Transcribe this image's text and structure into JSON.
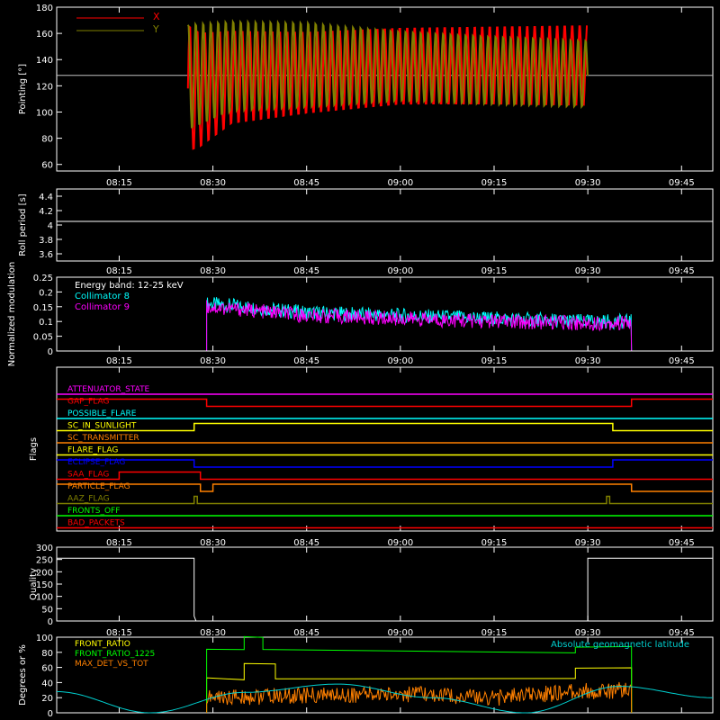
{
  "colors": {
    "background": "#000000",
    "axis": "#ffffff",
    "red": "#ff0000",
    "olive": "#808000",
    "cyan": "#00ffff",
    "magenta": "#ff00ff",
    "white": "#ffffff",
    "yellow": "#ffff00",
    "green": "#00ff00",
    "orange": "#ff8000",
    "blue": "#0000ff",
    "teal": "#00d0d0"
  },
  "time_axis": {
    "tick_labels": [
      "08:15",
      "08:30",
      "08:45",
      "09:00",
      "09:15",
      "09:30",
      "09:45"
    ],
    "start": "08:05",
    "end": "09:50"
  },
  "chart_data": [
    {
      "type": "line",
      "ylabel": "Pointing [°]",
      "ylim": [
        55,
        180
      ],
      "yticks": [
        60,
        80,
        100,
        120,
        140,
        160,
        180
      ],
      "reference_line": 128,
      "data_start": "08:26",
      "data_end": "09:30",
      "series": [
        {
          "name": "X",
          "color": "#ff0000",
          "envelope": [
            {
              "t": "08:26",
              "min": 68,
              "max": 168
            },
            {
              "t": "08:28",
              "min": 72,
              "max": 162
            },
            {
              "t": "08:33",
              "min": 90,
              "max": 163
            },
            {
              "t": "08:45",
              "min": 98,
              "max": 162
            },
            {
              "t": "09:00",
              "min": 105,
              "max": 165
            },
            {
              "t": "09:15",
              "min": 105,
              "max": 166
            },
            {
              "t": "09:30",
              "min": 104,
              "max": 167
            }
          ]
        },
        {
          "name": "Y",
          "color": "#808000",
          "envelope": [
            {
              "t": "08:26",
              "min": 85,
              "max": 168
            },
            {
              "t": "08:33",
              "min": 100,
              "max": 170
            },
            {
              "t": "08:45",
              "min": 103,
              "max": 169
            },
            {
              "t": "09:00",
              "min": 108,
              "max": 162
            },
            {
              "t": "09:15",
              "min": 105,
              "max": 158
            },
            {
              "t": "09:30",
              "min": 103,
              "max": 155
            }
          ]
        }
      ]
    },
    {
      "type": "line",
      "ylabel": "Roll period [s]",
      "ylim": [
        3.5,
        4.5
      ],
      "yticks": [
        3.6,
        3.8,
        4.0,
        4.2,
        4.4
      ],
      "series": [
        {
          "name": "",
          "color": "#ffffff",
          "x": [
            "08:05",
            "09:50"
          ],
          "y": [
            4.05,
            4.05
          ]
        }
      ]
    },
    {
      "type": "line",
      "ylabel": "Normalized modulation",
      "ylim": [
        0,
        0.25
      ],
      "yticks": [
        0.0,
        0.05,
        0.1,
        0.15,
        0.2,
        0.25
      ],
      "annotation": "Energy band: 12-25 keV",
      "data_start": "08:29",
      "data_end": "09:37",
      "series": [
        {
          "name": "Collimator 8",
          "color": "#00ffff",
          "x": [
            "08:29",
            "08:35",
            "08:45",
            "09:00",
            "09:15",
            "09:30",
            "09:37"
          ],
          "y": [
            0.16,
            0.15,
            0.13,
            0.12,
            0.11,
            0.1,
            0.1
          ]
        },
        {
          "name": "Collimator 9",
          "color": "#ff00ff",
          "x": [
            "08:29",
            "08:35",
            "08:45",
            "09:00",
            "09:15",
            "09:30",
            "09:37"
          ],
          "y": [
            0.15,
            0.14,
            0.12,
            0.11,
            0.1,
            0.095,
            0.095
          ]
        }
      ]
    },
    {
      "type": "table",
      "ylabel": "Flags",
      "flags": [
        {
          "name": "ATTENUATOR_STATE",
          "color": "#ff00ff",
          "x": [
            "08:05",
            "09:50"
          ],
          "y": [
            0,
            0
          ]
        },
        {
          "name": "GAP_FLAG",
          "color": "#ff0000",
          "x": [
            "08:05",
            "08:29",
            "08:29",
            "09:37",
            "09:37",
            "09:50"
          ],
          "y": [
            1,
            1,
            0,
            0,
            1,
            1
          ]
        },
        {
          "name": "POSSIBLE_FLARE",
          "color": "#00ffff",
          "x": [
            "08:05",
            "09:50"
          ],
          "y": [
            0,
            0
          ]
        },
        {
          "name": "SC_IN_SUNLIGHT",
          "color": "#ffff00",
          "x": [
            "08:05",
            "08:27",
            "08:27",
            "09:34",
            "09:34",
            "09:50"
          ],
          "y": [
            0,
            0,
            1,
            1,
            0,
            0
          ]
        },
        {
          "name": "SC_TRANSMITTER",
          "color": "#ff8000",
          "x": [
            "08:05",
            "09:50"
          ],
          "y": [
            0,
            0
          ]
        },
        {
          "name": "FLARE_FLAG",
          "color": "#ffff00",
          "x": [
            "08:05",
            "09:50"
          ],
          "y": [
            0,
            0
          ]
        },
        {
          "name": "ECLIPSE_FLAG",
          "color": "#0000ff",
          "x": [
            "08:05",
            "08:27",
            "08:27",
            "09:34",
            "09:34",
            "09:50"
          ],
          "y": [
            1,
            1,
            0,
            0,
            1,
            1
          ]
        },
        {
          "name": "SAA_FLAG",
          "color": "#ff0000",
          "x": [
            "08:05",
            "08:15",
            "08:15",
            "08:28",
            "08:28",
            "09:50"
          ],
          "y": [
            0,
            0,
            1,
            1,
            0,
            0
          ]
        },
        {
          "name": "PARTICLE_FLAG",
          "color": "#ff8000",
          "x": [
            "08:05",
            "08:28",
            "08:28",
            "08:30",
            "08:30",
            "09:37",
            "09:37",
            "09:50"
          ],
          "y": [
            1,
            1,
            0,
            0,
            1,
            1,
            0,
            0
          ]
        },
        {
          "name": "AAZ_FLAG",
          "color": "#808000",
          "x": [
            "08:05",
            "08:27",
            "08:27",
            "08:27.5",
            "08:27.5",
            "09:33",
            "09:33",
            "09:33.5",
            "09:33.5",
            "09:50"
          ],
          "y": [
            0,
            0,
            1,
            1,
            0,
            0,
            1,
            1,
            0,
            0
          ]
        },
        {
          "name": "FRONTS_OFF",
          "color": "#00ff00",
          "x": [
            "08:05",
            "09:50"
          ],
          "y": [
            0,
            0
          ]
        },
        {
          "name": "BAD_PACKETS",
          "color": "#ff0000",
          "x": [
            "08:05",
            "09:50"
          ],
          "y": [
            0,
            0
          ]
        }
      ]
    },
    {
      "type": "line",
      "ylabel": "Quality",
      "ylim": [
        0,
        300
      ],
      "yticks": [
        0,
        50,
        100,
        150,
        200,
        250,
        300
      ],
      "series": [
        {
          "name": "",
          "color": "#ffffff",
          "x": [
            "08:05",
            "08:27",
            "08:27",
            "08:27.3",
            "08:27.5",
            "09:30",
            "09:30",
            "09:50"
          ],
          "y": [
            255,
            255,
            20,
            0,
            0,
            0,
            255,
            255
          ]
        }
      ]
    },
    {
      "type": "line",
      "ylabel": "Degrees or %",
      "ylim": [
        0,
        100
      ],
      "yticks": [
        0,
        20,
        40,
        60,
        80,
        100
      ],
      "annotation": "Absolute geomagnetic latitude",
      "series": [
        {
          "name": "FRONT_RATIO",
          "color": "#ffff00",
          "x": [
            "08:29",
            "08:29",
            "08:35",
            "08:35",
            "08:40",
            "08:40",
            "09:28",
            "09:28",
            "09:37",
            "09:37"
          ],
          "y": [
            0,
            45,
            45,
            65,
            65,
            45,
            45,
            60,
            60,
            0
          ]
        },
        {
          "name": "FRONT_RATIO_1225",
          "color": "#00ff00",
          "x": [
            "08:29",
            "08:29",
            "08:35",
            "08:35",
            "08:38",
            "08:38",
            "09:28",
            "09:28",
            "09:37",
            "09:37"
          ],
          "y": [
            0,
            85,
            85,
            100,
            100,
            85,
            80,
            88,
            88,
            0
          ]
        },
        {
          "name": "MAX_DET_VS_TOT",
          "color": "#ff8000",
          "x": [
            "08:29",
            "08:40",
            "09:00",
            "09:15",
            "09:28",
            "09:37"
          ],
          "y": [
            20,
            22,
            25,
            20,
            28,
            30
          ]
        },
        {
          "name": "Absolute geomagnetic latitude",
          "color": "#00d0d0",
          "x": [
            "08:05",
            "08:20",
            "08:35",
            "08:50",
            "09:05",
            "09:20",
            "09:35",
            "09:50"
          ],
          "y": [
            28,
            0,
            27,
            38,
            20,
            0,
            35,
            20
          ]
        }
      ]
    }
  ]
}
